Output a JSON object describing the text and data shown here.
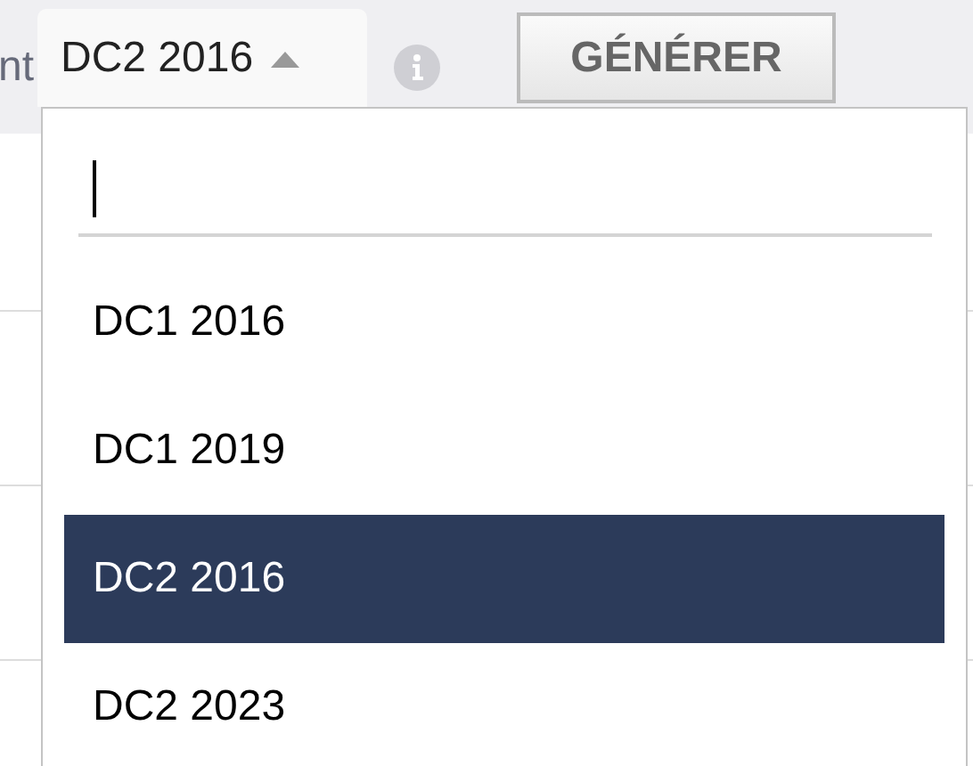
{
  "label": "nt",
  "select": {
    "value": "DC2 2016",
    "expanded": true
  },
  "generate_button": "GÉNÉRER",
  "dropdown": {
    "search": {
      "focused": true
    },
    "options": [
      {
        "label": "DC1 2016",
        "selected": false
      },
      {
        "label": "DC1 2019",
        "selected": false
      },
      {
        "label": "DC2 2016",
        "selected": true
      },
      {
        "label": "DC2 2023",
        "selected": false
      }
    ]
  }
}
